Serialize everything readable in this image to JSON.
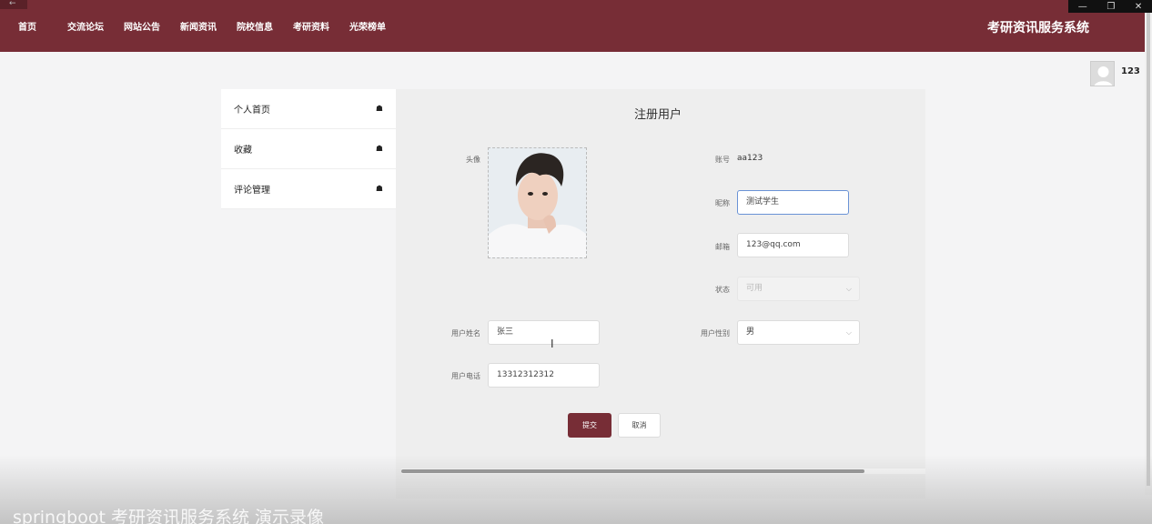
{
  "window": {
    "back": "←",
    "minimize": "—",
    "restore": "❐",
    "close": "✕"
  },
  "nav": {
    "items": [
      "首页",
      "交流论坛",
      "网站公告",
      "新闻资讯",
      "院校信息",
      "考研资料",
      "光荣榜单"
    ],
    "brand": "考研资讯服务系统"
  },
  "user": {
    "name": "123"
  },
  "sidebar": {
    "items": [
      {
        "label": "个人首页",
        "icon": "home-icon"
      },
      {
        "label": "收藏",
        "icon": "home-icon"
      },
      {
        "label": "评论管理",
        "icon": "home-icon"
      }
    ]
  },
  "form": {
    "title": "注册用户",
    "avatar_label": "头像",
    "account_label": "账号",
    "account_value": "aa123",
    "nickname_label": "昵称",
    "nickname_value": "测试学生",
    "email_label": "邮箱",
    "email_value": "123@qq.com",
    "status_label": "状态",
    "status_value": "可用",
    "realname_label": "用户姓名",
    "realname_value": "张三",
    "gender_label": "用户性别",
    "gender_value": "男",
    "phone_label": "用户电话",
    "phone_value": "13312312312",
    "submit": "提交",
    "cancel": "取消"
  },
  "colors": {
    "primary": "#772d36",
    "focus": "#6a93d6",
    "panel": "#eeeeee"
  },
  "watermark": "springboot 考研资讯服务系统 演示录像"
}
